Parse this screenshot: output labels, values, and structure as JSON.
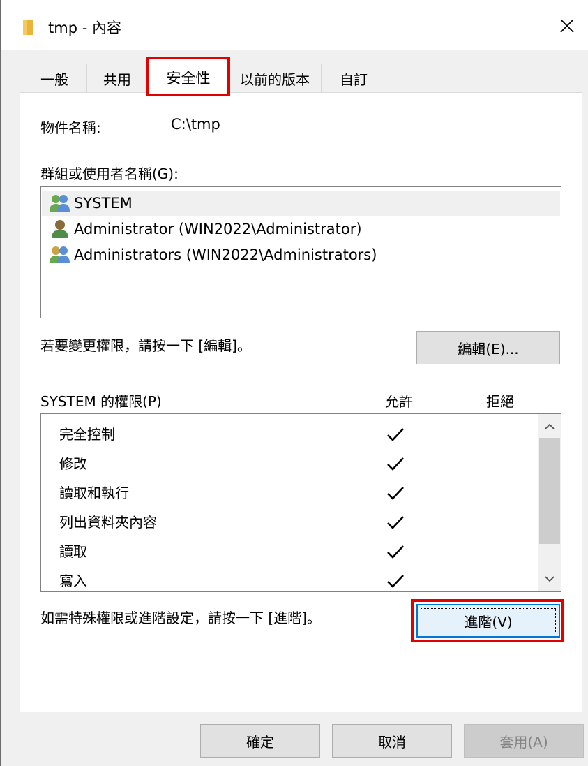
{
  "window": {
    "title": "tmp - 內容"
  },
  "tabs": [
    {
      "label": "一般"
    },
    {
      "label": "共用"
    },
    {
      "label": "安全性"
    },
    {
      "label": "以前的版本"
    },
    {
      "label": "自訂"
    }
  ],
  "security": {
    "object_name_label": "物件名稱:",
    "object_name_value": "C:\\tmp",
    "groups_label": "群組或使用者名稱(G):",
    "principals": [
      {
        "name": "SYSTEM",
        "icon": "group-users-icon"
      },
      {
        "name": "Administrator (WIN2022\\Administrator)",
        "icon": "user-icon"
      },
      {
        "name": "Administrators (WIN2022\\Administrators)",
        "icon": "group-users-icon"
      }
    ],
    "edit_hint": "若要變更權限，請按一下 [編輯]。",
    "edit_button": "編輯(E)...",
    "permissions_label": "SYSTEM 的權限(P)",
    "allow_header": "允許",
    "deny_header": "拒絕",
    "permissions": [
      {
        "name": "完全控制",
        "allow": true,
        "deny": false
      },
      {
        "name": "修改",
        "allow": true,
        "deny": false
      },
      {
        "name": "讀取和執行",
        "allow": true,
        "deny": false
      },
      {
        "name": "列出資料夾內容",
        "allow": true,
        "deny": false
      },
      {
        "name": "讀取",
        "allow": true,
        "deny": false
      },
      {
        "name": "寫入",
        "allow": true,
        "deny": false
      }
    ],
    "advanced_hint": "如需特殊權限或進階設定，請按一下 [進階]。",
    "advanced_button": "進階(V)"
  },
  "footer": {
    "ok": "確定",
    "cancel": "取消",
    "apply": "套用(A)"
  },
  "colors": {
    "highlight": "#e30000",
    "focus_border": "#0078d7"
  }
}
